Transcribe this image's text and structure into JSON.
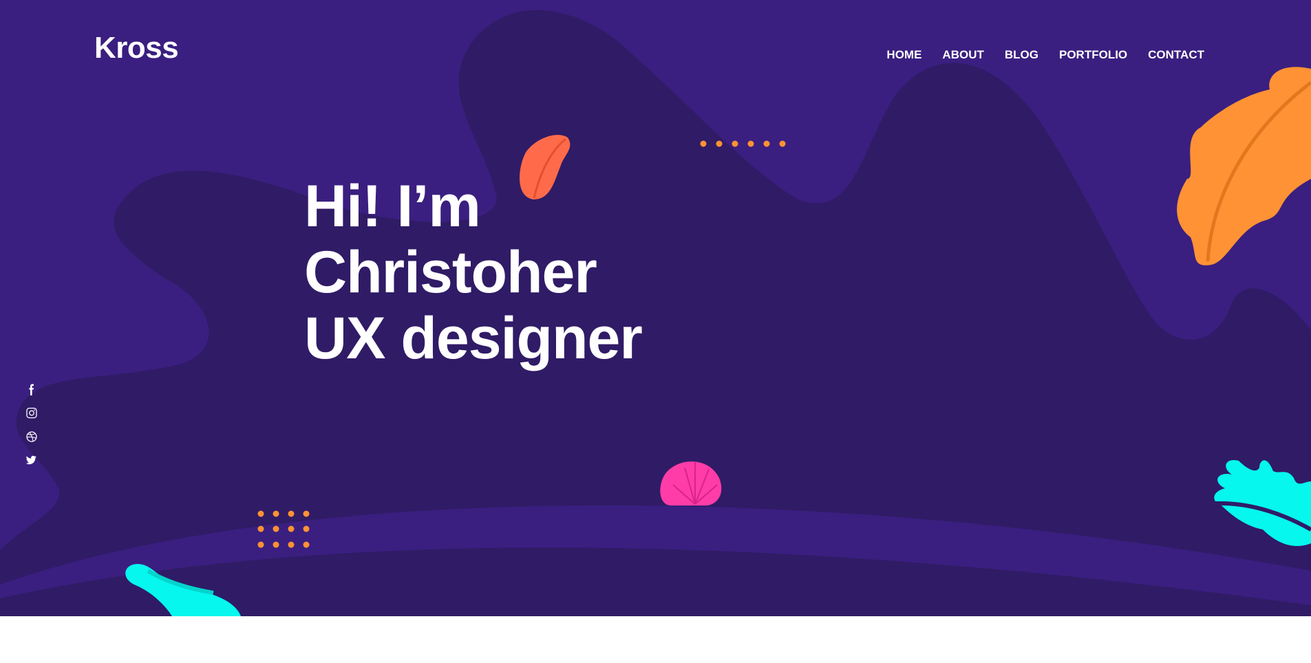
{
  "brand": {
    "name": "Kross"
  },
  "nav": {
    "items": [
      {
        "label": "HOME"
      },
      {
        "label": "ABOUT"
      },
      {
        "label": "BLOG"
      },
      {
        "label": "PORTFOLIO"
      },
      {
        "label": "CONTACT"
      }
    ]
  },
  "hero": {
    "lines": [
      "Hi! I’m",
      "Christoher",
      "UX designer"
    ]
  },
  "social": {
    "icons": [
      "facebook-icon",
      "instagram-icon",
      "dribbble-icon",
      "twitter-icon"
    ]
  },
  "colors": {
    "background": "#3a1f80",
    "blob": "#301b66",
    "text": "#ffffff",
    "orange_leaf": "#ff9234",
    "coral_leaf": "#ff6b4a",
    "pink_shell": "#ff3ca8",
    "cyan_leaf": "#05f7ee",
    "dots": "#ff9234",
    "page_bottom": "#ffffff"
  }
}
